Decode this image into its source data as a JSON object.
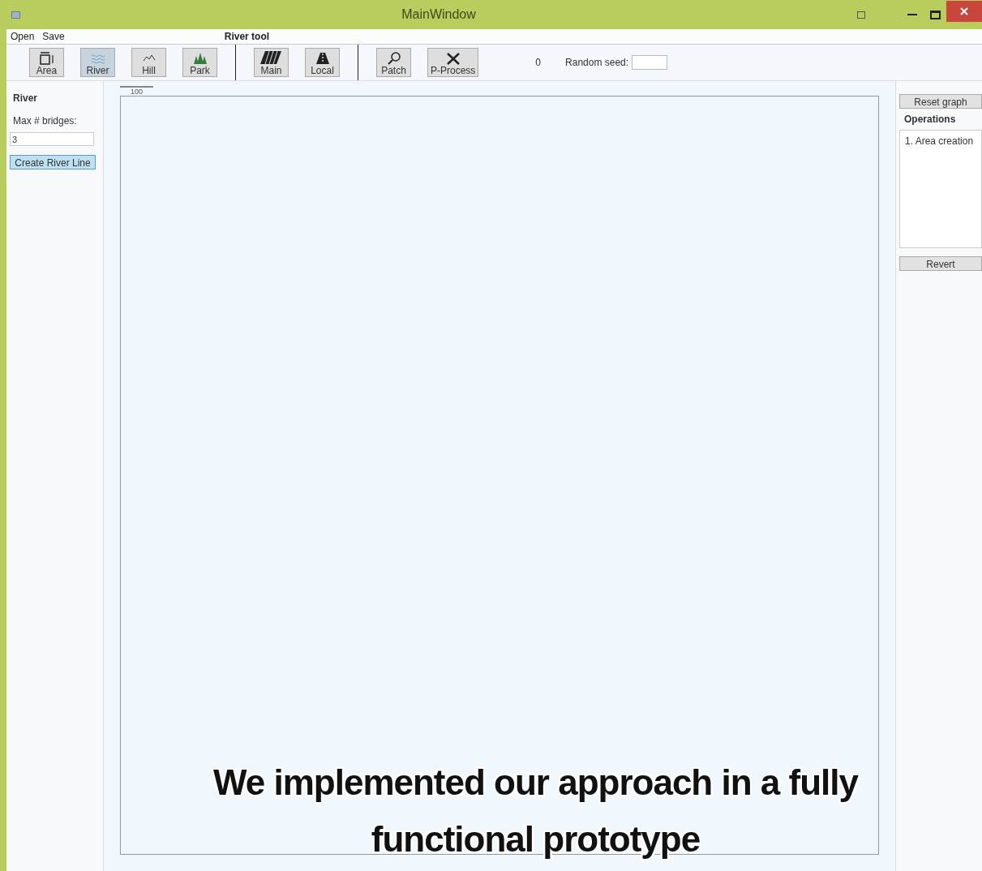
{
  "window": {
    "title": "MainWindow"
  },
  "menu": [
    "Open",
    "Save"
  ],
  "tool_title": "River tool",
  "tool_groups": [
    [
      {
        "kind": "area",
        "label": "Area",
        "selected": false
      },
      {
        "kind": "river",
        "label": "River",
        "selected": true
      },
      {
        "kind": "hill",
        "label": "Hill",
        "selected": false
      },
      {
        "kind": "park",
        "label": "Park",
        "selected": false
      }
    ],
    [
      {
        "kind": "main",
        "label": "Main",
        "selected": false
      },
      {
        "kind": "local",
        "label": "Local",
        "selected": false
      }
    ],
    [
      {
        "kind": "patch",
        "label": "Patch",
        "selected": false
      },
      {
        "kind": "process",
        "label": "P-Process",
        "selected": false
      }
    ]
  ],
  "counter": "0",
  "random_seed": {
    "label": "Random seed:"
  },
  "left_panel": {
    "title": "River",
    "field_label": "Max # bridges:",
    "field_value": "3",
    "button": "Create River Line"
  },
  "canvas": {
    "scale_label": "100"
  },
  "right_panel": {
    "reset_button": "Reset graph",
    "operations_title": "Operations",
    "operations": [
      "1. Area creation"
    ],
    "revert_button": "Revert"
  },
  "caption": [
    "We implemented our approach in a fully",
    "functional prototype"
  ]
}
